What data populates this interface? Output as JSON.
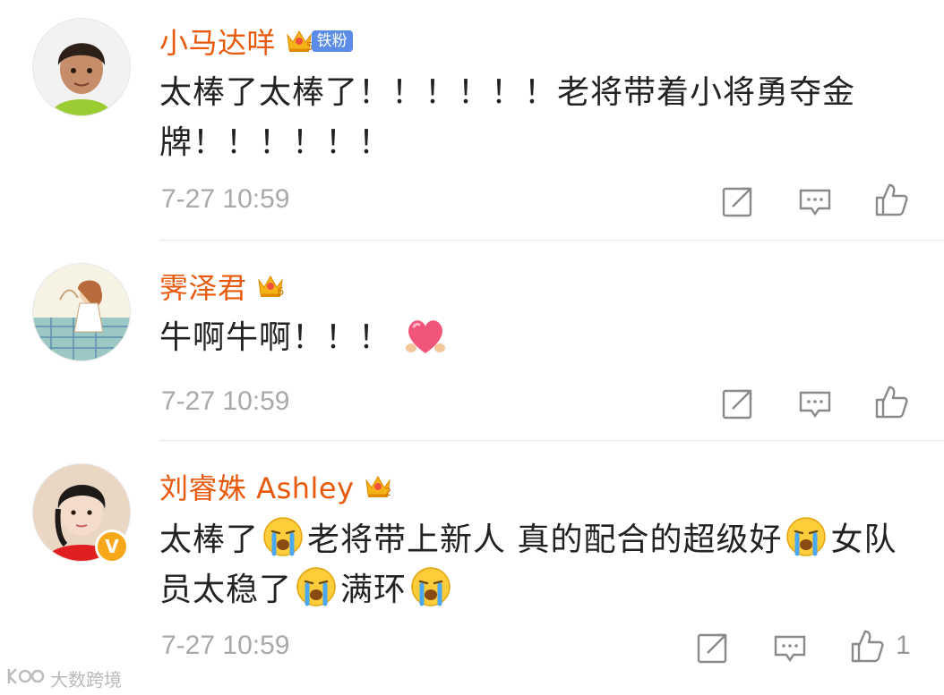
{
  "comments": [
    {
      "username": "小马达咩",
      "crown_level": "5",
      "fan_badge": "铁粉",
      "text": "太棒了太棒了！！！！！！老将带着小将勇夺金牌！！！！！！",
      "time": "7-27 10:59",
      "likes": ""
    },
    {
      "username": "霁泽君",
      "crown_level": "6",
      "text": "牛啊牛啊！！！",
      "time": "7-27 10:59",
      "likes": ""
    },
    {
      "username": "刘睿姝 Ashley",
      "crown_level": "2",
      "verified_mark": "V",
      "text_parts": [
        "太棒了",
        "老将带上新人 真的配合的超级好",
        "女队员太稳了",
        "满环"
      ],
      "time": "7-27 10:59",
      "likes": "1"
    }
  ],
  "watermark": {
    "text": "大数跨境"
  },
  "colors": {
    "username": "#e8590c",
    "fan_badge": "#5b8de8",
    "meta": "#a9a9a9",
    "divider": "#e6e6e6"
  },
  "icons": [
    "forward-icon",
    "comment-icon",
    "like-icon",
    "crying-emoji-icon",
    "heart-emoji-icon",
    "crown-icon"
  ]
}
